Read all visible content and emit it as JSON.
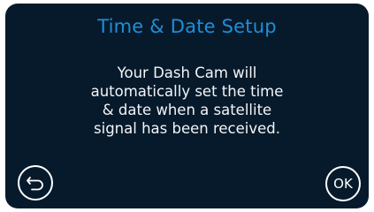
{
  "screen": {
    "title": "Time & Date Setup",
    "message": "Your Dash Cam will\nautomatically set the time\n& date when a satellite\nsignal has been received."
  },
  "buttons": {
    "back": {
      "icon": "back-arrow-icon"
    },
    "ok": {
      "label": "OK"
    }
  },
  "colors": {
    "background": "#071a2b",
    "title": "#1f8ed8",
    "text": "#f2f5f8",
    "button_outline": "#ffffff"
  }
}
